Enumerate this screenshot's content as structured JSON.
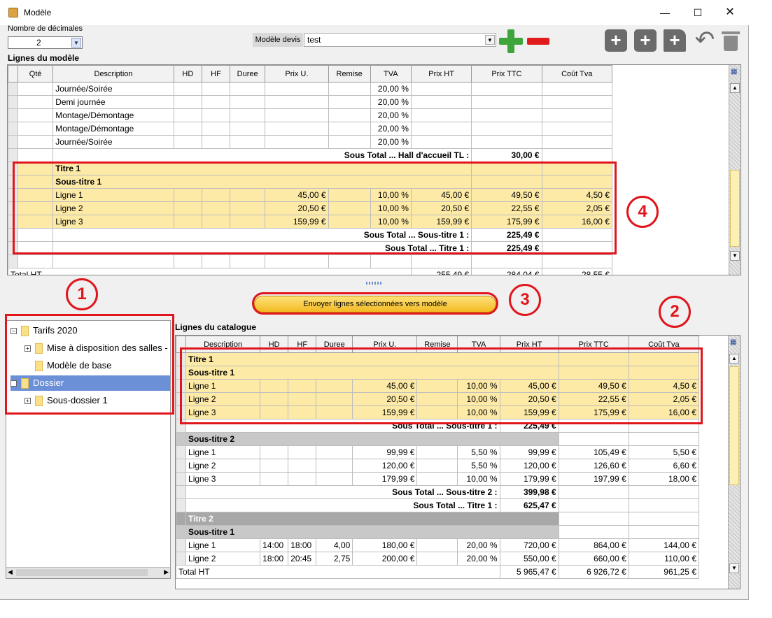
{
  "window": {
    "title": "Modèle",
    "min_icon": "minimize-icon",
    "max_icon": "maximize-icon",
    "close_icon": "close-icon"
  },
  "decimals": {
    "label": "Nombre de décimales",
    "value": "2"
  },
  "modele_devis": {
    "label": "Modèle devis",
    "value": "test"
  },
  "lignes_modele": {
    "label": "Lignes du modèle",
    "headers": [
      "Qté",
      "Description",
      "HD",
      "HF",
      "Duree",
      "Prix U.",
      "Remise",
      "TVA",
      "Prix HT",
      "Prix TTC",
      "Coût Tva"
    ],
    "rows": [
      {
        "type": "line",
        "desc": "Journée/Soirée",
        "tva": "20,00 %"
      },
      {
        "type": "line",
        "desc": "Demi journée",
        "tva": "20,00 %"
      },
      {
        "type": "line",
        "desc": "Montage/Démontage",
        "tva": "20,00 %"
      },
      {
        "type": "line",
        "desc": "Montage/Démontage",
        "tva": "20,00 %"
      },
      {
        "type": "line",
        "desc": "Journée/Soirée",
        "tva": "20,00 %"
      },
      {
        "type": "subtotal",
        "label": "Sous Total ... Hall d'accueil TL :",
        "value": "30,00 €"
      },
      {
        "type": "title",
        "desc": "Titre 1"
      },
      {
        "type": "subtitle",
        "desc": "Sous-titre 1"
      },
      {
        "type": "sel",
        "desc": "Ligne 1",
        "pu": "45,00 €",
        "tva": "10,00 %",
        "ht": "45,00 €",
        "ttc": "49,50 €",
        "ctva": "4,50 €"
      },
      {
        "type": "sel",
        "desc": "Ligne 2",
        "pu": "20,50 €",
        "tva": "10,00 %",
        "ht": "20,50 €",
        "ttc": "22,55 €",
        "ctva": "2,05 €"
      },
      {
        "type": "sel",
        "desc": "Ligne 3",
        "pu": "159,99 €",
        "tva": "10,00 %",
        "ht": "159,99 €",
        "ttc": "175,99 €",
        "ctva": "16,00 €"
      },
      {
        "type": "subtotal",
        "label": "Sous Total ... Sous-titre 1 :",
        "value": "225,49 €"
      },
      {
        "type": "subtotal",
        "label": "Sous Total ... Titre 1 :",
        "value": "225,49 €"
      }
    ],
    "total": {
      "label": "Total HT",
      "ht": "255,49 €",
      "ttc": "284,04 €",
      "ctva": "28,55 €"
    }
  },
  "send_button": "Envoyer lignes sélectionnées vers modèle",
  "tree": [
    {
      "label": "Tarifs 2020",
      "level": 0,
      "expander": "minus"
    },
    {
      "label": "Mise à disposition des salles -",
      "level": 1,
      "expander": "plus"
    },
    {
      "label": "Modèle de base",
      "level": 1,
      "expander": "none"
    },
    {
      "label": "Dossier",
      "level": 0,
      "expander": "minus",
      "selected": true
    },
    {
      "label": "Sous-dossier 1",
      "level": 1,
      "expander": "plus"
    }
  ],
  "lignes_catalogue": {
    "label": "Lignes du catalogue",
    "headers": [
      "Description",
      "HD",
      "HF",
      "Duree",
      "Prix U.",
      "Remise",
      "TVA",
      "Prix HT",
      "Prix TTC",
      "Coût Tva"
    ],
    "rows": [
      {
        "type": "title",
        "desc": "Titre 1"
      },
      {
        "type": "subtitle",
        "desc": "Sous-titre 1"
      },
      {
        "type": "sel",
        "desc": "Ligne 1",
        "pu": "45,00 €",
        "tva": "10,00 %",
        "ht": "45,00 €",
        "ttc": "49,50 €",
        "ctva": "4,50 €"
      },
      {
        "type": "sel",
        "desc": "Ligne 2",
        "pu": "20,50 €",
        "tva": "10,00 %",
        "ht": "20,50 €",
        "ttc": "22,55 €",
        "ctva": "2,05 €"
      },
      {
        "type": "sel",
        "desc": "Ligne 3",
        "pu": "159,99 €",
        "tva": "10,00 %",
        "ht": "159,99 €",
        "ttc": "175,99 €",
        "ctva": "16,00 €"
      },
      {
        "type": "subtotal",
        "label": "Sous Total ... Sous-titre 1 :",
        "value": "225,49 €"
      },
      {
        "type": "grey1",
        "desc": "Sous-titre 2"
      },
      {
        "type": "line",
        "desc": "Ligne 1",
        "pu": "99,99 €",
        "tva": "5,50 %",
        "ht": "99,99 €",
        "ttc": "105,49 €",
        "ctva": "5,50 €"
      },
      {
        "type": "line",
        "desc": "Ligne 2",
        "pu": "120,00 €",
        "tva": "5,50 %",
        "ht": "120,00 €",
        "ttc": "126,60 €",
        "ctva": "6,60 €"
      },
      {
        "type": "line",
        "desc": "Ligne 3",
        "pu": "179,99 €",
        "tva": "10,00 %",
        "ht": "179,99 €",
        "ttc": "197,99 €",
        "ctva": "18,00 €"
      },
      {
        "type": "subtotal",
        "label": "Sous Total ... Sous-titre 2 :",
        "value": "399,98 €"
      },
      {
        "type": "subtotal",
        "label": "Sous Total ... Titre 1 :",
        "value": "625,47 €"
      },
      {
        "type": "grey2",
        "desc": "Titre 2"
      },
      {
        "type": "grey1",
        "desc": "Sous-titre 1"
      },
      {
        "type": "line",
        "desc": "Ligne 1",
        "hd": "14:00",
        "hf": "18:00",
        "duree": "4,00",
        "pu": "180,00 €",
        "tva": "20,00 %",
        "ht": "720,00 €",
        "ttc": "864,00 €",
        "ctva": "144,00 €"
      },
      {
        "type": "line",
        "desc": "Ligne 2",
        "hd": "18:00",
        "hf": "20:45",
        "duree": "2,75",
        "pu": "200,00 €",
        "tva": "20,00 %",
        "ht": "550,00 €",
        "ttc": "660,00 €",
        "ctva": "110,00 €"
      }
    ],
    "total": {
      "label": "Total HT",
      "ht": "5 965,47 €",
      "ttc": "6 926,72 €",
      "ctva": "961,25 €"
    }
  },
  "callouts": [
    "1",
    "2",
    "3",
    "4"
  ],
  "accent_red": "#e0161c"
}
